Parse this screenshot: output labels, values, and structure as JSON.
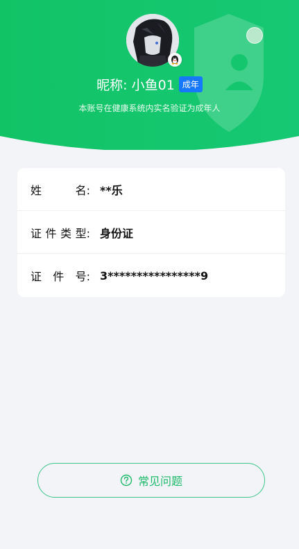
{
  "header": {
    "nickname": "昵称: 小鱼01",
    "adult_badge": "成年",
    "verify_note": "本账号在健康系统内实名验证为成年人"
  },
  "identity": {
    "rows": [
      {
        "label": [
          "姓",
          "名:"
        ],
        "value": "**乐"
      },
      {
        "label": [
          "证",
          "件",
          "类",
          "型:"
        ],
        "value": "身份证"
      },
      {
        "label": [
          "证",
          "件",
          "号:"
        ],
        "value": "3****************9"
      }
    ]
  },
  "faq": {
    "label": "常见问题",
    "icon": "question-circle-icon"
  },
  "colors": {
    "header_green": "#12c569",
    "badge_blue": "#1677ff",
    "faq_green": "#1fba6a",
    "page_bg": "#f2f4f7"
  }
}
